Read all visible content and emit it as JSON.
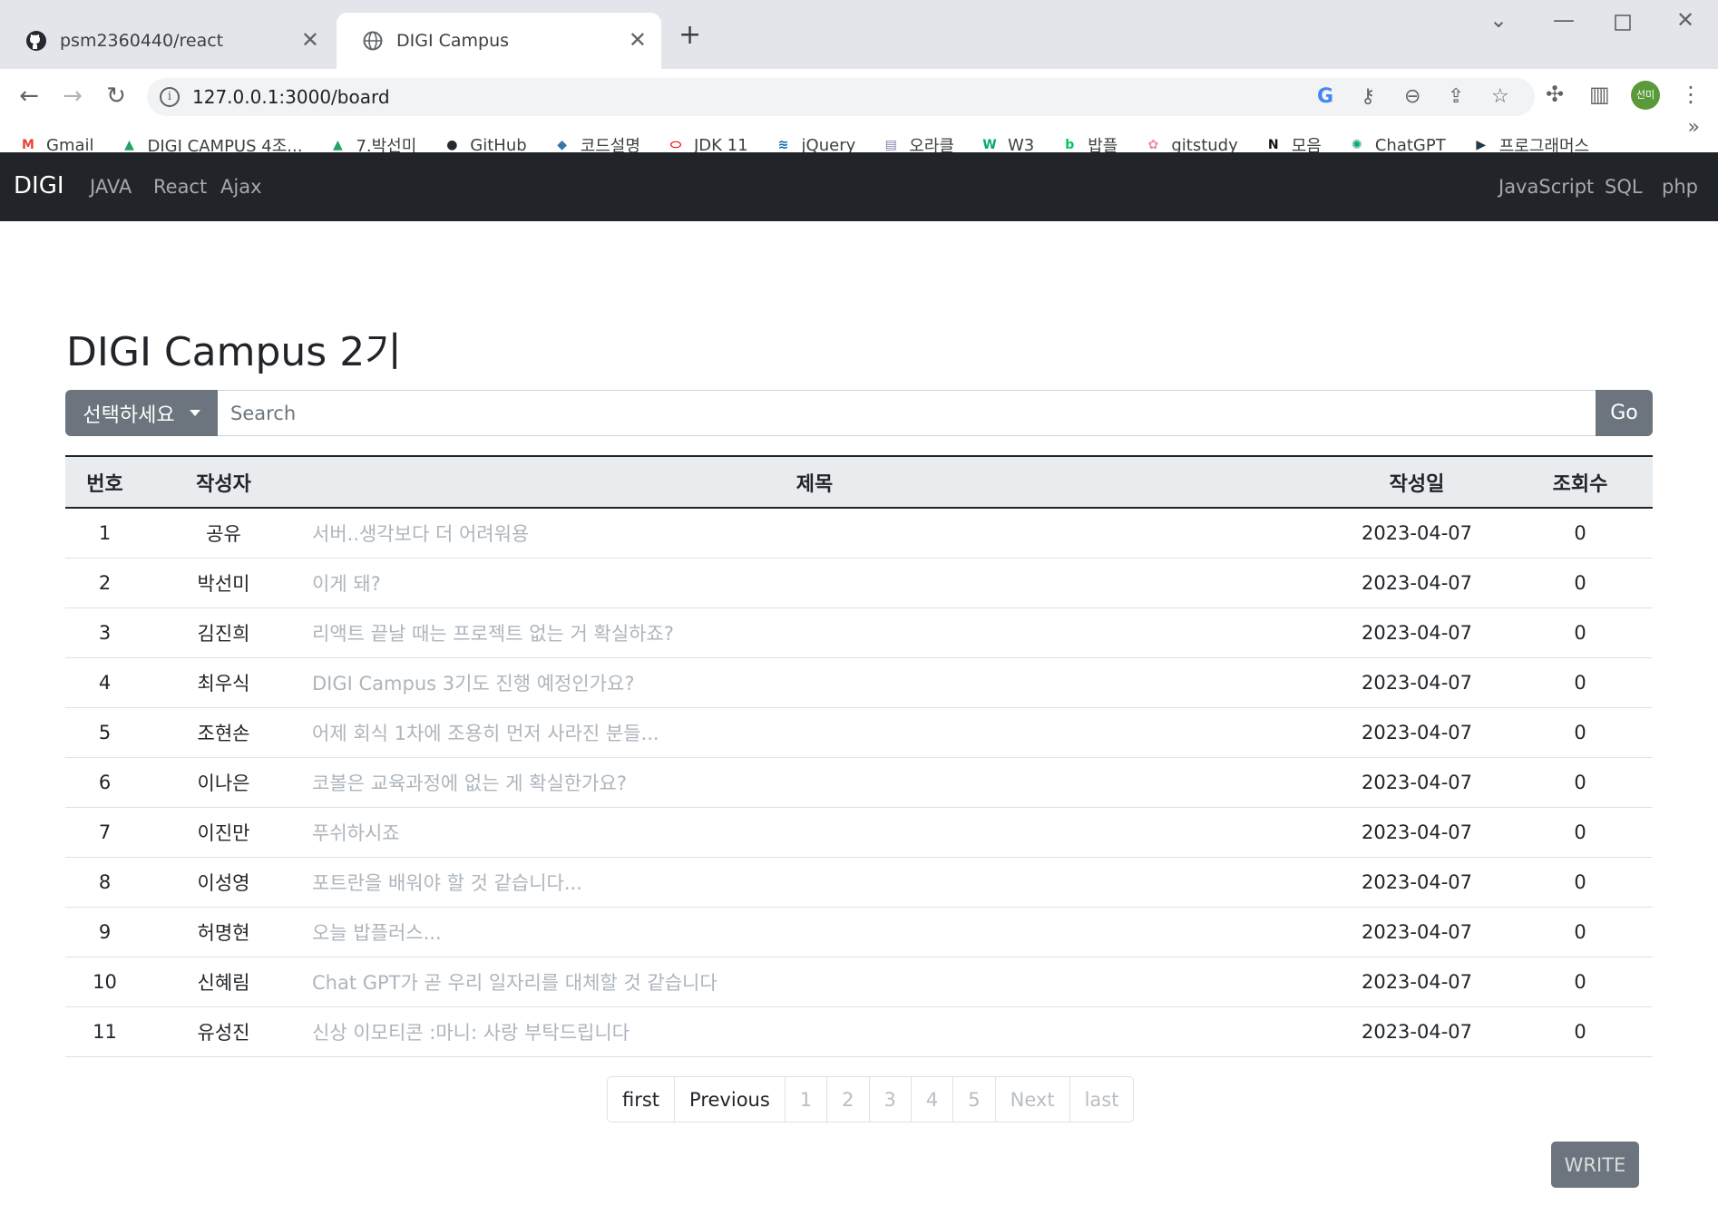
{
  "browser": {
    "tabs": [
      {
        "title": "psm2360440/react",
        "icon": "github-icon"
      },
      {
        "title": "DIGI Campus",
        "icon": "globe-icon"
      }
    ],
    "url": "127.0.0.1:3000/board",
    "avatar_text": "선미",
    "bookmarks": [
      {
        "label": "Gmail",
        "icon": "gmail-icon",
        "color": "#ea4335"
      },
      {
        "label": "DIGI CAMPUS 4조...",
        "icon": "google-drive-icon",
        "color": "#1fa463"
      },
      {
        "label": "7.박선미",
        "icon": "google-drive-icon",
        "color": "#1fa463"
      },
      {
        "label": "GitHub",
        "icon": "github-icon",
        "color": "#24292f"
      },
      {
        "label": "코드설명",
        "icon": "python-icon",
        "color": "#3776ab"
      },
      {
        "label": "JDK 11",
        "icon": "oracle-icon",
        "color": "#f80000"
      },
      {
        "label": "jQuery",
        "icon": "jquery-icon",
        "color": "#0769ad"
      },
      {
        "label": "오라클",
        "icon": "page-icon",
        "color": "#7b7fa8"
      },
      {
        "label": "W3",
        "icon": "w3-icon",
        "color": "#04aa6d"
      },
      {
        "label": "밥플",
        "icon": "blog-icon",
        "color": "#03c75a"
      },
      {
        "label": "gitstudy",
        "icon": "flower-icon",
        "color": "#e98ab0"
      },
      {
        "label": "모음",
        "icon": "notion-icon",
        "color": "#111111"
      },
      {
        "label": "ChatGPT",
        "icon": "chatgpt-icon",
        "color": "#10a37f"
      },
      {
        "label": "프로그래머스",
        "icon": "programmers-icon",
        "color": "#263747"
      }
    ]
  },
  "navbar": {
    "brand": "DIGI",
    "left_links": [
      "JAVA",
      "React",
      "Ajax"
    ],
    "right_links": [
      "JavaScript",
      "SQL",
      "php"
    ]
  },
  "page": {
    "title": "DIGI Campus 2기",
    "search": {
      "select_label": "선택하세요",
      "placeholder": "Search",
      "go_label": "Go"
    },
    "table": {
      "headers": [
        "번호",
        "작성자",
        "제목",
        "작성일",
        "조회수"
      ],
      "rows": [
        {
          "no": "1",
          "writer": "공유",
          "title": "서버..생각보다 더 어려워용",
          "date": "2023-04-07",
          "views": "0"
        },
        {
          "no": "2",
          "writer": "박선미",
          "title": "이게 돼?",
          "date": "2023-04-07",
          "views": "0"
        },
        {
          "no": "3",
          "writer": "김진희",
          "title": "리액트 끝날 때는 프로젝트 없는 거 확실하죠?",
          "date": "2023-04-07",
          "views": "0"
        },
        {
          "no": "4",
          "writer": "최우식",
          "title": "DIGI Campus 3기도 진행 예정인가요?",
          "date": "2023-04-07",
          "views": "0"
        },
        {
          "no": "5",
          "writer": "조현손",
          "title": "어제 회식 1차에 조용히 먼저 사라진 분들...",
          "date": "2023-04-07",
          "views": "0"
        },
        {
          "no": "6",
          "writer": "이나은",
          "title": "코볼은 교육과정에 없는 게 확실한가요?",
          "date": "2023-04-07",
          "views": "0"
        },
        {
          "no": "7",
          "writer": "이진만",
          "title": "푸쉬하시죠",
          "date": "2023-04-07",
          "views": "0"
        },
        {
          "no": "8",
          "writer": "이성영",
          "title": "포트란을 배워야 할 것 같습니다...",
          "date": "2023-04-07",
          "views": "0"
        },
        {
          "no": "9",
          "writer": "허명현",
          "title": "오늘 밥플러스...",
          "date": "2023-04-07",
          "views": "0"
        },
        {
          "no": "10",
          "writer": "신혜림",
          "title": "Chat GPT가 곧 우리 일자리를 대체할 것 같습니다",
          "date": "2023-04-07",
          "views": "0"
        },
        {
          "no": "11",
          "writer": "유성진",
          "title": "신상 이모티콘 :마니: 사랑 부탁드립니다",
          "date": "2023-04-07",
          "views": "0"
        }
      ]
    },
    "pagination": [
      "first",
      "Previous",
      "1",
      "2",
      "3",
      "4",
      "5",
      "Next",
      "last"
    ],
    "write_label": "WRITE"
  }
}
